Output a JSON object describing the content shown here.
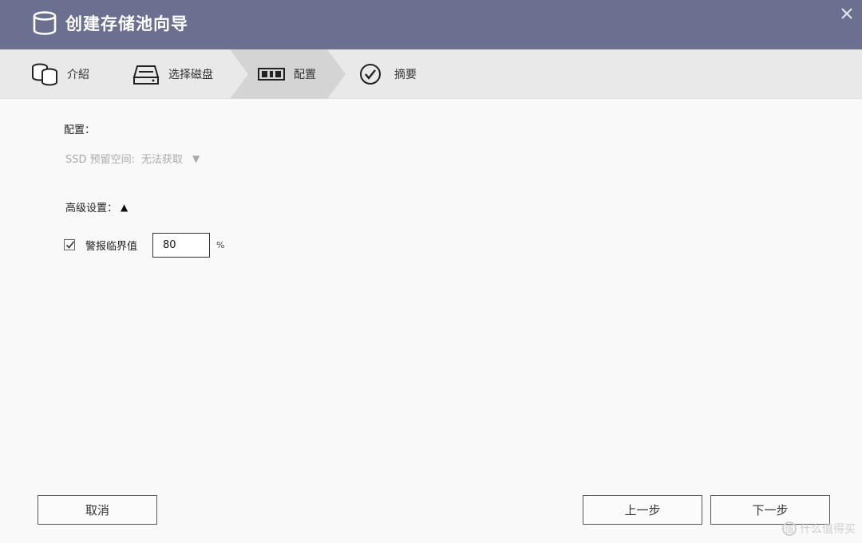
{
  "window": {
    "title": "创建存储池向导",
    "title_icon": "database-icon",
    "close_icon": "close-icon"
  },
  "steps": [
    {
      "label": "介紹",
      "icon": "storage-pool-icon",
      "active": false
    },
    {
      "label": "选择磁盘",
      "icon": "disk-drive-icon",
      "active": false
    },
    {
      "label": "配置",
      "icon": "raid-config-icon",
      "active": true
    },
    {
      "label": "摘要",
      "icon": "checkmark-circle-icon",
      "active": false
    }
  ],
  "config": {
    "section_label": "配置：",
    "ssd_label": "SSD 预留空间:",
    "ssd_value": "无法获取",
    "ssd_arrow": "▼"
  },
  "advanced": {
    "label": "高级设置：",
    "arrow": "▲",
    "alert_threshold": {
      "checked": true,
      "label": "警报临界值",
      "value": "80",
      "unit": "%"
    }
  },
  "buttons": {
    "cancel": "取消",
    "prev": "上一步",
    "next": "下一步"
  },
  "watermark": {
    "icon_text": "值",
    "text": "什么值得买"
  },
  "colors": {
    "titlebar": "#6b7090",
    "stepbar": "#e9e9e9",
    "active_step": "#d4d4d4",
    "background": "#f9f9f9"
  }
}
